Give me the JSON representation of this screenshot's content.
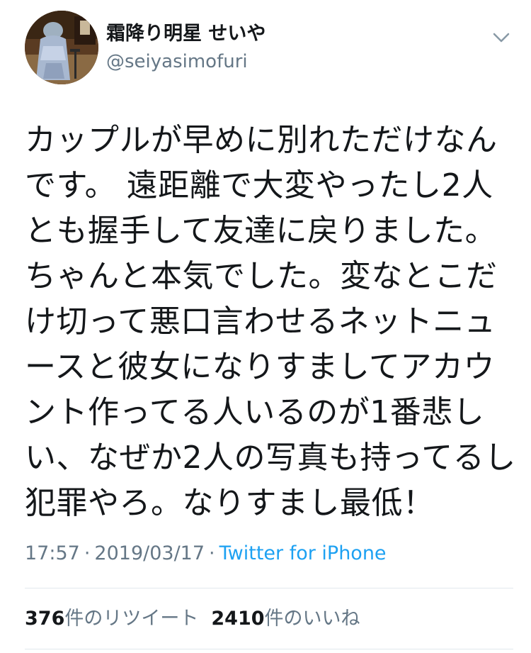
{
  "user": {
    "display_name": "霜降り明星 せいや",
    "handle": "@seiyasimofuri"
  },
  "tweet": {
    "text": "カップルが早めに別れただけなん\nです。 遠距離で大変やったし2人\nとも握手して友達に戻りました。\nちゃんと本気でした。変なとこだ\nけ切って悪口言わせるネットニュ\nースと彼女になりすましてアカウ\nント作ってる人いるのが1番悲し\nい、なぜか2人の写真も持ってるし\n犯罪やろ。なりすまし最低！",
    "time": "17:57",
    "separator": "·",
    "date": "2019/03/17",
    "source": "Twitter for iPhone"
  },
  "stats": {
    "retweets_count": "376",
    "retweets_label": "件のリツイート",
    "likes_count": "2410",
    "likes_label": "件のいいね"
  },
  "icons": {
    "menu": "chevron-down-icon",
    "avatar": "avatar-photo"
  },
  "colors": {
    "text_primary": "#14171a",
    "text_secondary": "#657786",
    "link": "#1da1f2",
    "divider": "#e1e8ed"
  }
}
